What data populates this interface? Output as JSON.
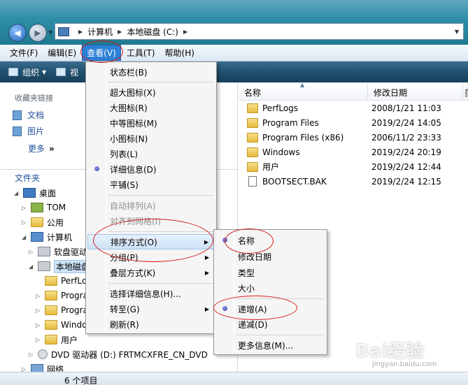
{
  "address": {
    "crumbs": [
      "计算机",
      "本地磁盘 (C:)"
    ]
  },
  "menubar": {
    "items": [
      "文件(F)",
      "编辑(E)",
      "查看(V)",
      "工具(T)",
      "帮助(H)"
    ],
    "active": "查看(V)"
  },
  "toolbar": {
    "organize": "组织",
    "views_partial": "视"
  },
  "favorites": {
    "title": "收藏夹链接",
    "items": [
      "文档",
      "图片"
    ],
    "more": "更多"
  },
  "folders": {
    "title": "文件夹"
  },
  "tree": [
    "桌面",
    "TOM",
    "公用",
    "计算机",
    "软盘驱动器",
    "本地磁盘",
    "PerfLogs",
    "Program Files",
    "Program Files (x86)",
    "Windows",
    "用户",
    "DVD 驱动器 (D:) FRTMCXFRE_CN_DVD",
    "网络"
  ],
  "columns": {
    "name": "名称",
    "date": "修改日期",
    "type_partial": "类"
  },
  "files": [
    {
      "name": "PerfLogs",
      "date": "2008/1/21 11:03",
      "icon": "folder-icon"
    },
    {
      "name": "Program Files",
      "date": "2019/2/24 14:05",
      "icon": "folder-icon"
    },
    {
      "name": "Program Files (x86)",
      "date": "2006/11/2 23:33",
      "icon": "folder-icon"
    },
    {
      "name": "Windows",
      "date": "2019/2/24 20:19",
      "icon": "folder-icon"
    },
    {
      "name": "用户",
      "date": "2019/2/24 12:44",
      "icon": "folder-icon"
    },
    {
      "name": "BOOTSECT.BAK",
      "date": "2019/2/24 12:15",
      "icon": "file-icon"
    }
  ],
  "status": {
    "text": "6 个项目"
  },
  "view_menu": {
    "items": [
      "状态栏(B)",
      "超大图标(X)",
      "大图标(R)",
      "中等图标(M)",
      "小图标(N)",
      "列表(L)",
      "详细信息(D)",
      "平铺(S)",
      "自动排列(A)",
      "对齐到网格(I)",
      "排序方式(O)",
      "分组(P)",
      "叠层方式(K)",
      "选择详细信息(H)...",
      "转至(G)",
      "刷新(R)"
    ]
  },
  "sort_menu": {
    "items": [
      "名称",
      "修改日期",
      "类型",
      "大小",
      "递增(A)",
      "递减(D)",
      "更多信息(M)..."
    ]
  },
  "watermark": {
    "text": "Bai经验",
    "sub": "jingyan.baidu.com"
  },
  "colors": {
    "menu_active": "#2d7fd6",
    "annotation": "#d81a1a",
    "link": "#1e4f9b"
  }
}
